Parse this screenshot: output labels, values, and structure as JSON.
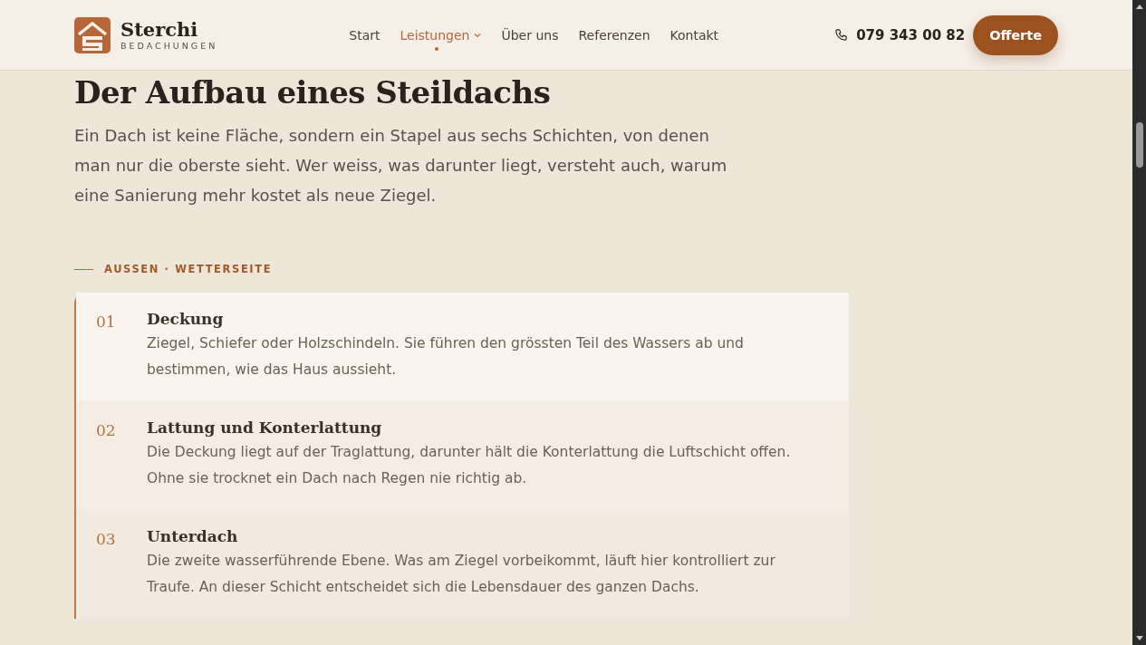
{
  "header": {
    "logo_name": "Sterchi",
    "logo_sub": "BEDACHUNGEN",
    "nav": [
      {
        "label": "Start",
        "selected": false,
        "dropdown": false
      },
      {
        "label": "Leistungen",
        "selected": true,
        "dropdown": true
      },
      {
        "label": "Über uns",
        "selected": false,
        "dropdown": false
      },
      {
        "label": "Referenzen",
        "selected": false,
        "dropdown": false
      },
      {
        "label": "Kontakt",
        "selected": false,
        "dropdown": false
      }
    ],
    "phone": "079 343 00 82",
    "cta": "Offerte"
  },
  "heading": "Der Aufbau eines Steildachs",
  "intro": "Ein Dach ist keine Fläche, sondern ein Stapel aus sechs Schichten, von denen man nur die oberste sieht. Wer weiss, was darunter liegt, versteht auch, warum eine Sanierung mehr kostet als neue Ziegel.",
  "section_label": "AUSSEN · WETTERSEITE",
  "layers": [
    {
      "number": "01",
      "title": "Deckung",
      "text": "Ziegel, Schiefer oder Holzschindeln. Sie führen den grössten Teil des Wassers ab und bestimmen, wie das Haus aussieht."
    },
    {
      "number": "02",
      "title": "Lattung und Konterlattung",
      "text": "Die Deckung liegt auf der Traglattung, darunter hält die Konterlattung die Luftschicht offen. Ohne sie trocknet ein Dach nach Regen nie richtig ab."
    },
    {
      "number": "03",
      "title": "Unterdach",
      "text": "Die zweite wasserführende Ebene. Was am Ziegel vorbeikommt, läuft hier kontrolliert zur Traufe. An dieser Schicht entscheidet sich die Lebensdauer des ganzen Dachs."
    }
  ]
}
